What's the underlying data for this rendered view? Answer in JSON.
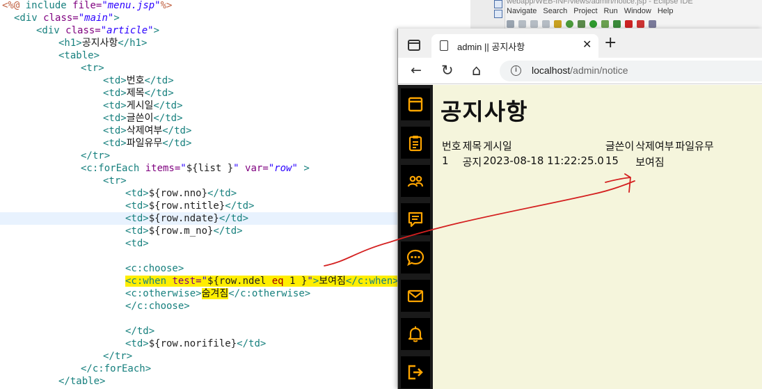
{
  "editor": {
    "lines": [
      {
        "segments": [
          {
            "c": "jsp",
            "t": "<%@ "
          },
          {
            "c": "tag",
            "t": "include "
          },
          {
            "c": "attr",
            "t": "file="
          },
          {
            "c": "str",
            "t": "\"menu.jsp\""
          },
          {
            "c": "jsp",
            "t": "%>"
          }
        ],
        "indent": 3
      },
      {
        "segments": [
          {
            "c": "tag",
            "t": "<div "
          },
          {
            "c": "attr",
            "t": "class="
          },
          {
            "c": "str",
            "t": "\"main\""
          },
          {
            "c": "tag",
            "t": ">"
          }
        ],
        "indent": 20
      },
      {
        "segments": [
          {
            "c": "tag",
            "t": "<div "
          },
          {
            "c": "attr",
            "t": "class="
          },
          {
            "c": "str",
            "t": "\"article\""
          },
          {
            "c": "tag",
            "t": ">"
          }
        ],
        "indent": 52
      },
      {
        "segments": [
          {
            "c": "tag",
            "t": "<h1>"
          },
          {
            "c": "txt",
            "t": "공지사항"
          },
          {
            "c": "tag",
            "t": "</h1>"
          }
        ],
        "indent": 84
      },
      {
        "segments": [
          {
            "c": "tag",
            "t": "<table>"
          }
        ],
        "indent": 84
      },
      {
        "segments": [
          {
            "c": "tag",
            "t": "<tr>"
          }
        ],
        "indent": 116
      },
      {
        "segments": [
          {
            "c": "tag",
            "t": "<td>"
          },
          {
            "c": "txt",
            "t": "번호"
          },
          {
            "c": "tag",
            "t": "</td>"
          }
        ],
        "indent": 148
      },
      {
        "segments": [
          {
            "c": "tag",
            "t": "<td>"
          },
          {
            "c": "txt",
            "t": "제목"
          },
          {
            "c": "tag",
            "t": "</td>"
          }
        ],
        "indent": 148
      },
      {
        "segments": [
          {
            "c": "tag",
            "t": "<td>"
          },
          {
            "c": "txt",
            "t": "게시일"
          },
          {
            "c": "tag",
            "t": "</td>"
          }
        ],
        "indent": 148
      },
      {
        "segments": [
          {
            "c": "tag",
            "t": "<td>"
          },
          {
            "c": "txt",
            "t": "글쓴이"
          },
          {
            "c": "tag",
            "t": "</td>"
          }
        ],
        "indent": 148
      },
      {
        "segments": [
          {
            "c": "tag",
            "t": "<td>"
          },
          {
            "c": "txt",
            "t": "삭제여부"
          },
          {
            "c": "tag",
            "t": "</td>"
          }
        ],
        "indent": 148
      },
      {
        "segments": [
          {
            "c": "tag",
            "t": "<td>"
          },
          {
            "c": "txt",
            "t": "파일유무"
          },
          {
            "c": "tag",
            "t": "</td>"
          }
        ],
        "indent": 148
      },
      {
        "segments": [
          {
            "c": "tag",
            "t": "</tr>"
          }
        ],
        "indent": 116
      },
      {
        "segments": [
          {
            "c": "tag",
            "t": "<c:forEach "
          },
          {
            "c": "attr",
            "t": "items="
          },
          {
            "c": "str",
            "t": "\""
          },
          {
            "c": "el",
            "t": "${list }"
          },
          {
            "c": "str",
            "t": "\" "
          },
          {
            "c": "attr",
            "t": "var="
          },
          {
            "c": "str",
            "t": "\"row\""
          },
          {
            "c": "tag",
            "t": " >"
          }
        ],
        "indent": 116
      },
      {
        "segments": [
          {
            "c": "tag",
            "t": "<tr>"
          }
        ],
        "indent": 148
      },
      {
        "segments": [
          {
            "c": "tag",
            "t": "<td>"
          },
          {
            "c": "el",
            "t": "${row.nno}"
          },
          {
            "c": "tag",
            "t": "</td>"
          }
        ],
        "indent": 180
      },
      {
        "segments": [
          {
            "c": "tag",
            "t": "<td>"
          },
          {
            "c": "el",
            "t": "${row.ntitle}"
          },
          {
            "c": "tag",
            "t": "</td>"
          }
        ],
        "indent": 180
      },
      {
        "segments": [
          {
            "c": "tag",
            "t": "<td>"
          },
          {
            "c": "el",
            "t": "${row.ndate}"
          },
          {
            "c": "tag",
            "t": "</td>"
          }
        ],
        "indent": 180,
        "current": true
      },
      {
        "segments": [
          {
            "c": "tag",
            "t": "<td>"
          },
          {
            "c": "el",
            "t": "${row.m_no}"
          },
          {
            "c": "tag",
            "t": "</td>"
          }
        ],
        "indent": 180
      },
      {
        "segments": [
          {
            "c": "tag",
            "t": "<td>"
          }
        ],
        "indent": 180
      },
      {
        "segments": [],
        "indent": 180
      },
      {
        "segments": [
          {
            "c": "tag",
            "t": "<c:choose>"
          }
        ],
        "indent": 180
      },
      {
        "segments": [
          {
            "c": "tag hl",
            "t": "<c:when "
          },
          {
            "c": "attr hl",
            "t": "test="
          },
          {
            "c": "str hl",
            "t": "\""
          },
          {
            "c": "el hl",
            "t": "${row.ndel "
          },
          {
            "c": "kw hl",
            "t": "eq"
          },
          {
            "c": "el hl",
            "t": " 1 }"
          },
          {
            "c": "str hl",
            "t": "\""
          },
          {
            "c": "tag hl",
            "t": ">"
          },
          {
            "c": "txt hl",
            "t": "보여짐"
          },
          {
            "c": "tag hl",
            "t": "</c:when>"
          }
        ],
        "indent": 180
      },
      {
        "segments": [
          {
            "c": "tag",
            "t": "<c:otherwise>"
          },
          {
            "c": "txt hl",
            "t": "숨겨짐"
          },
          {
            "c": "tag",
            "t": "</c:otherwise>"
          }
        ],
        "indent": 180
      },
      {
        "segments": [
          {
            "c": "tag",
            "t": "</c:choose>"
          }
        ],
        "indent": 180
      },
      {
        "segments": [],
        "indent": 180
      },
      {
        "segments": [
          {
            "c": "tag",
            "t": "</td>"
          }
        ],
        "indent": 180
      },
      {
        "segments": [
          {
            "c": "tag",
            "t": "<td>"
          },
          {
            "c": "el",
            "t": "${row.norifile}"
          },
          {
            "c": "tag",
            "t": "</td>"
          }
        ],
        "indent": 180
      },
      {
        "segments": [
          {
            "c": "tag",
            "t": "</tr>"
          }
        ],
        "indent": 148
      },
      {
        "segments": [
          {
            "c": "tag",
            "t": "</c:forEach>"
          }
        ],
        "indent": 116
      },
      {
        "segments": [
          {
            "c": "tag",
            "t": "</table>"
          }
        ],
        "indent": 84
      }
    ]
  },
  "eclipse": {
    "title": "webapp/WEB-INF/views/admin/notice.jsp - Eclipse IDE",
    "menu": [
      "Navigate",
      "Search",
      "Project",
      "Run",
      "Window",
      "Help"
    ]
  },
  "browser": {
    "tab_title": "admin || 공지사항",
    "tab_close": "✕",
    "new_tab": "+",
    "back": "←",
    "reload": "↻",
    "home": "⌂",
    "address_host": "localhost",
    "address_path": "/admin/notice",
    "info": "i"
  },
  "page": {
    "heading": "공지사항",
    "menu_icons": [
      "panel-icon",
      "clipboard-icon",
      "users-icon",
      "message-square-icon",
      "chat-bubble-icon",
      "mail-icon",
      "bell-icon",
      "logout-icon"
    ],
    "accent": "#ffa500",
    "table": {
      "headers": [
        "번호",
        "제목",
        "게시일",
        "글쓴이",
        "삭제여부",
        "파일유무"
      ],
      "rows": [
        [
          "1",
          "공지",
          "2023-08-18 11:22:25.0",
          "15",
          "보여짐",
          ""
        ]
      ]
    }
  }
}
